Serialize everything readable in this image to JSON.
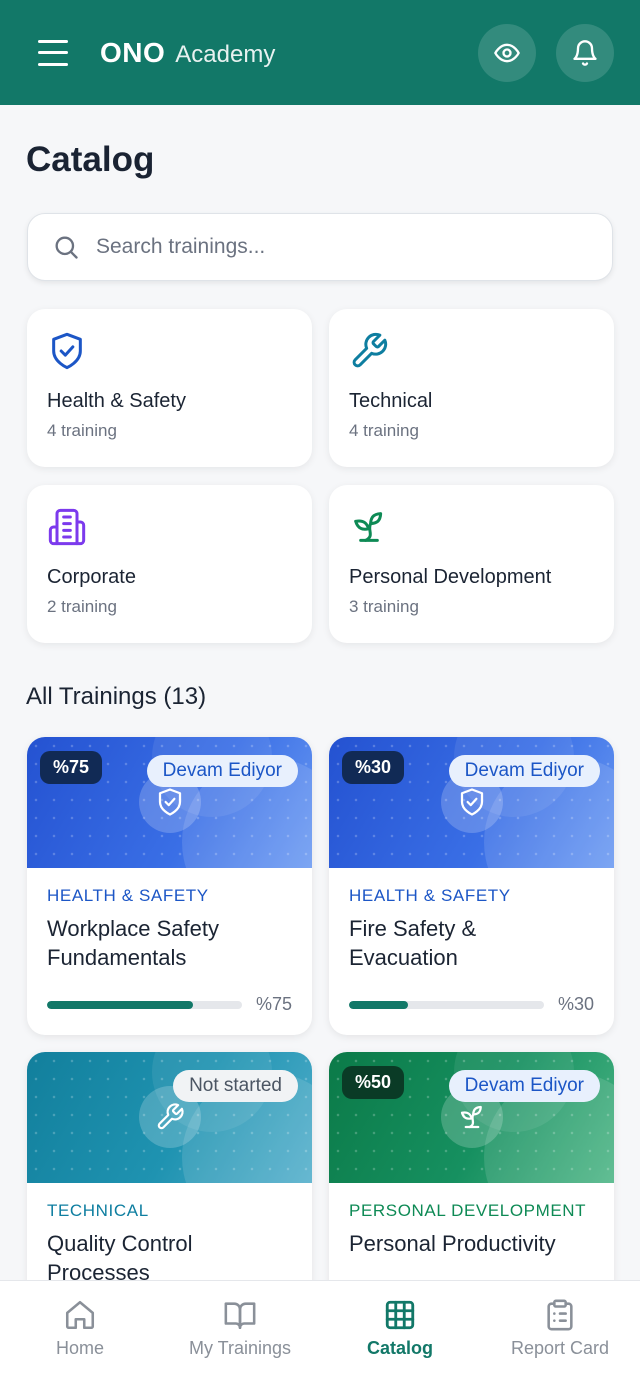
{
  "header": {
    "brand_bold": "ONO",
    "brand_light": "Academy"
  },
  "page": {
    "title": "Catalog"
  },
  "search": {
    "placeholder": "Search trainings..."
  },
  "categories": [
    {
      "name": "Health & Safety",
      "count": "4 training",
      "icon": "shield-check-icon",
      "color": "#1c56c6"
    },
    {
      "name": "Technical",
      "count": "4 training",
      "icon": "wrench-icon",
      "color": "#0e7ea0"
    },
    {
      "name": "Corporate",
      "count": "2 training",
      "icon": "building-icon",
      "color": "#7c3aed"
    },
    {
      "name": "Personal Development",
      "count": "3 training",
      "icon": "sprout-icon",
      "color": "#0e8a55"
    }
  ],
  "all_trainings": {
    "title": "All Trainings (13)",
    "items": [
      {
        "category": "HEALTH & SAFETY",
        "category_color": "#1c56c6",
        "title_line1": "Workplace Safety",
        "title_line2": "Fundamentals",
        "percent_badge": "%75",
        "status": "Devam Ediyor",
        "progress_label": "%75",
        "progress": 0.75,
        "icon": "shield-check-icon",
        "gradient": [
          "#2557d6",
          "#5b8ff0"
        ]
      },
      {
        "category": "HEALTH & SAFETY",
        "category_color": "#1c56c6",
        "title_line1": "Fire Safety &",
        "title_line2": "Evacuation",
        "percent_badge": "%30",
        "status": "Devam Ediyor",
        "progress_label": "%30",
        "progress": 0.3,
        "icon": "shield-check-icon",
        "gradient": [
          "#2557d6",
          "#5b8ff0"
        ]
      },
      {
        "category": "TECHNICAL",
        "category_color": "#0e7ea0",
        "title_line1": "Quality Control",
        "title_line2": "Processes",
        "percent_badge": "",
        "status": "Not started",
        "progress_label": "",
        "icon": "wrench-icon",
        "gradient": [
          "#14849f",
          "#4aa9c4"
        ]
      },
      {
        "category": "PERSONAL DEVELOPMENT",
        "category_color": "#0e8a55",
        "title_line1": "Personal Productivity",
        "title_line2": "",
        "percent_badge": "%50",
        "status": "Devam Ediyor",
        "progress_label": "",
        "icon": "sprout-icon",
        "gradient": [
          "#0d7d4c",
          "#3fae7a"
        ]
      }
    ]
  },
  "bottom_nav": [
    {
      "label": "Home",
      "icon": "home-icon",
      "active": false
    },
    {
      "label": "My Trainings",
      "icon": "book-open-icon",
      "active": false
    },
    {
      "label": "Catalog",
      "icon": "grid-icon",
      "active": true
    },
    {
      "label": "Report Card",
      "icon": "clipboard-icon",
      "active": false
    }
  ],
  "colors": {
    "primary": "#127868",
    "badge_dark": "#112a55",
    "status_bg": "#e8f0fd"
  }
}
